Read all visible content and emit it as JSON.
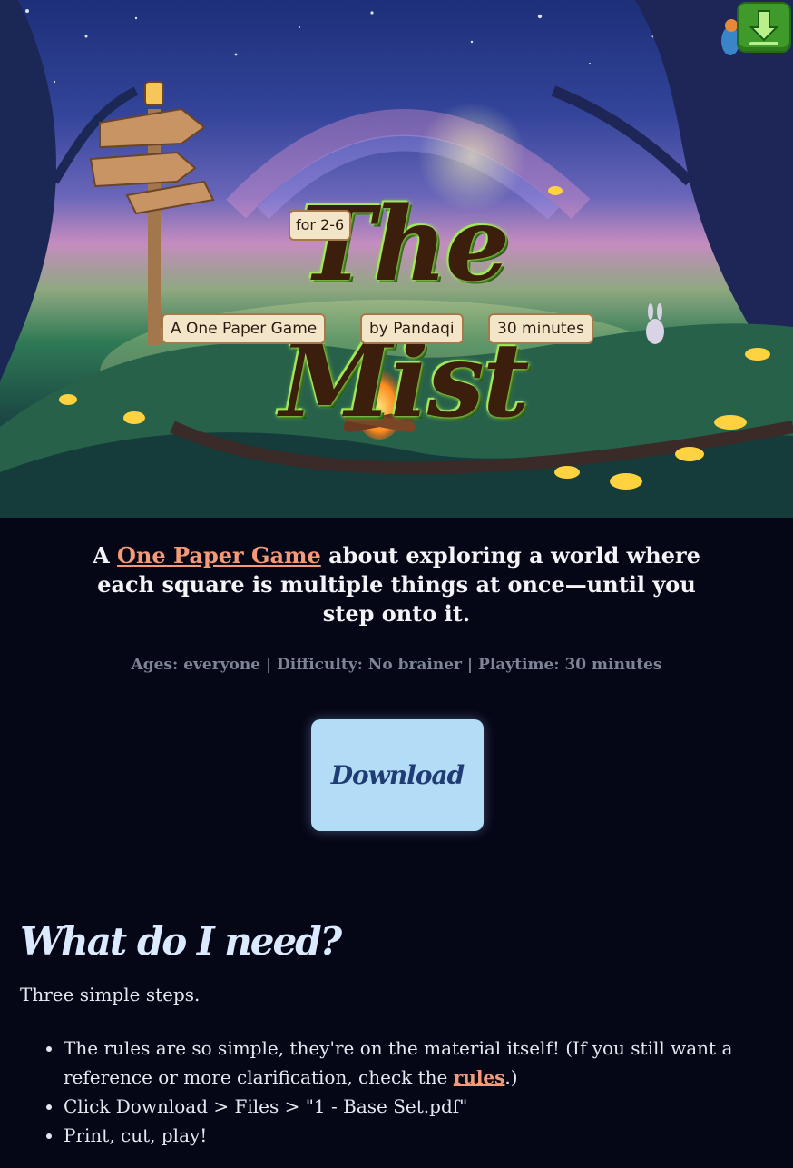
{
  "hero": {
    "title": "The Mist",
    "players_badge": "for 2-6",
    "label_left": "A One Paper Game",
    "label_middle": "by Pandaqi",
    "label_right": "30 minutes",
    "corner_icon": "download-arrow-icon"
  },
  "intro": {
    "before_link": "A ",
    "link_text": "One Paper Game",
    "after_link": " about exploring a world where each square is multiple things at once—until you step onto it."
  },
  "meta": "Ages: everyone | Difficulty: No brainer | Playtime: 30 minutes",
  "download_label": "Download",
  "needs": {
    "heading": "What do I need?",
    "subtitle": "Three simple steps.",
    "steps": {
      "s1_before": "The rules are so simple, they're on the material itself! (If you still want a reference or more clarification, check the ",
      "s1_link": "rules",
      "s1_after": ".)",
      "s2": "Click Download > Files > \"1 - Base Set.pdf\"",
      "s3": "Print, cut, play!"
    }
  },
  "colors": {
    "background": "#050616",
    "link": "#f49a78",
    "button": "#b3ddf7",
    "button_text": "#1f3d74"
  }
}
